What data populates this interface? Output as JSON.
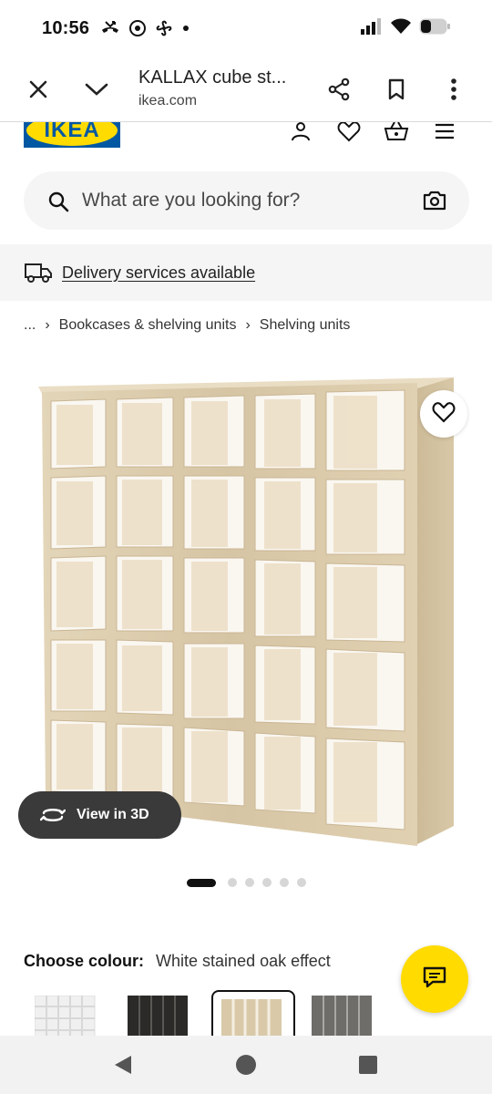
{
  "status_bar": {
    "time": "10:56",
    "icons": [
      "missed-call-icon",
      "chrome-icon",
      "fan-icon",
      "notification-dot-icon",
      "signal-icon",
      "wifi-icon",
      "battery-icon"
    ]
  },
  "browser": {
    "page_title": "KALLAX cube st...",
    "url": "ikea.com",
    "icons": [
      "close-icon",
      "chevron-down-icon",
      "share-icon",
      "bookmark-icon",
      "more-vert-icon"
    ]
  },
  "site_header": {
    "logo_text": "IKEA",
    "icons": [
      "account-icon",
      "wishlist-heart-icon",
      "basket-icon",
      "menu-icon"
    ]
  },
  "search": {
    "placeholder": "What are you looking for?"
  },
  "delivery": {
    "text": "Delivery services available"
  },
  "breadcrumb": {
    "ellipsis": "...",
    "items": [
      "Bookcases & shelving units",
      "Shelving units"
    ]
  },
  "gallery": {
    "view_3d_label": "View in 3D",
    "total_images": 6,
    "active_index": 0
  },
  "colour": {
    "label": "Choose colour:",
    "selected": "White stained oak effect",
    "swatches": [
      "white",
      "black-brown",
      "white stained oak effect",
      "grey"
    ]
  },
  "colors": {
    "ikea_blue": "#0058a3",
    "ikea_yellow": "#ffdb00",
    "oak": "#d9c9a9"
  }
}
